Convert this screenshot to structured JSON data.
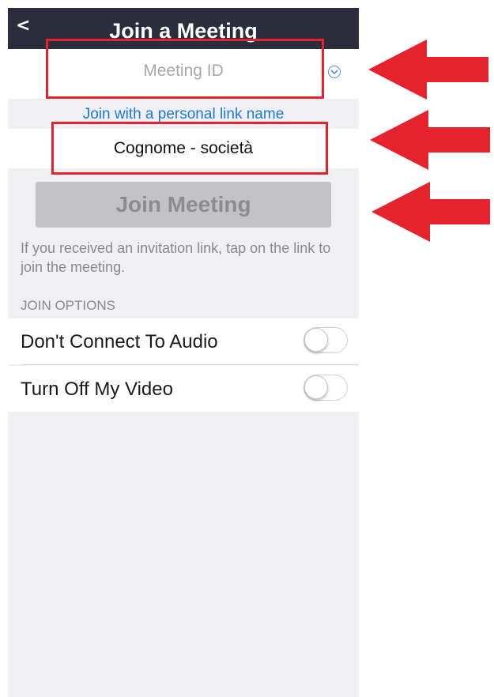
{
  "nav": {
    "back_glyph": "<",
    "title": "Join a Meeting"
  },
  "meeting_id": {
    "placeholder": "Meeting ID",
    "dropdown_icon": "chevron-down-circle-icon"
  },
  "personal_link": {
    "label": "Join with a personal link name"
  },
  "name_field": {
    "value": "Cognome - società"
  },
  "join_button": {
    "label": "Join Meeting",
    "enabled": false
  },
  "hint": {
    "text": "If you received an invitation link, tap on the link to join the meeting."
  },
  "join_options": {
    "header": "JOIN OPTIONS",
    "options": [
      {
        "label": "Don't Connect To Audio",
        "enabled": false
      },
      {
        "label": "Turn Off My Video",
        "enabled": false
      }
    ]
  },
  "annotations": {
    "highlight_color": "#e5232e",
    "arrow_icon": "red-left-arrow-icon"
  },
  "colors": {
    "nav_background": "#2b2d3d",
    "link_blue": "#1b7ad6",
    "page_background": "#efeff4"
  }
}
